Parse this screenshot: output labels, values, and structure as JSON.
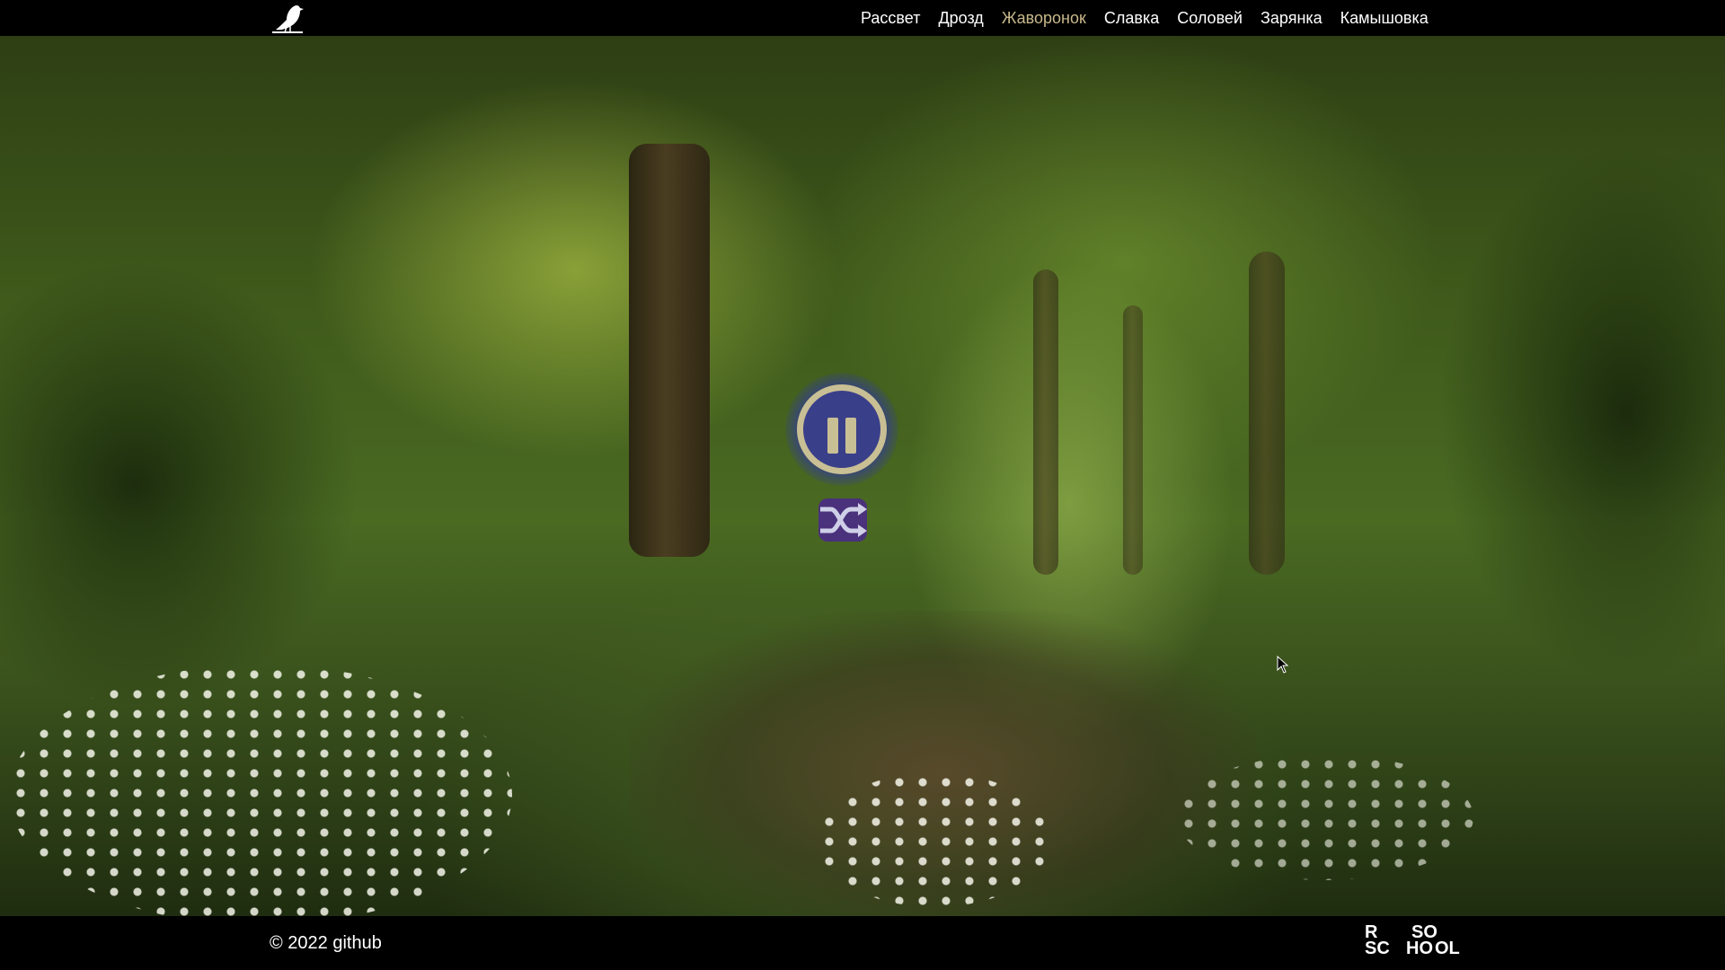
{
  "header": {
    "logo_icon": "bird-icon",
    "nav": [
      {
        "label": "Рассвет",
        "active": false
      },
      {
        "label": "Дрозд",
        "active": false
      },
      {
        "label": "Жаворонок",
        "active": true
      },
      {
        "label": "Славка",
        "active": false
      },
      {
        "label": "Соловей",
        "active": false
      },
      {
        "label": "Зарянка",
        "active": false
      },
      {
        "label": "Камышовка",
        "active": false
      }
    ]
  },
  "player": {
    "state": "playing",
    "main_icon": "pause-icon",
    "secondary_icon": "shuffle-icon"
  },
  "footer": {
    "copyright": "© 2022 github",
    "school_logo": {
      "icon": "rs-school-logo",
      "text": "RS SCHOOL"
    }
  },
  "colors": {
    "active_nav": "#c8b88a",
    "ring": "#c9bf95",
    "button_fill": "#3a3f8a",
    "bar_bg": "#000000"
  }
}
